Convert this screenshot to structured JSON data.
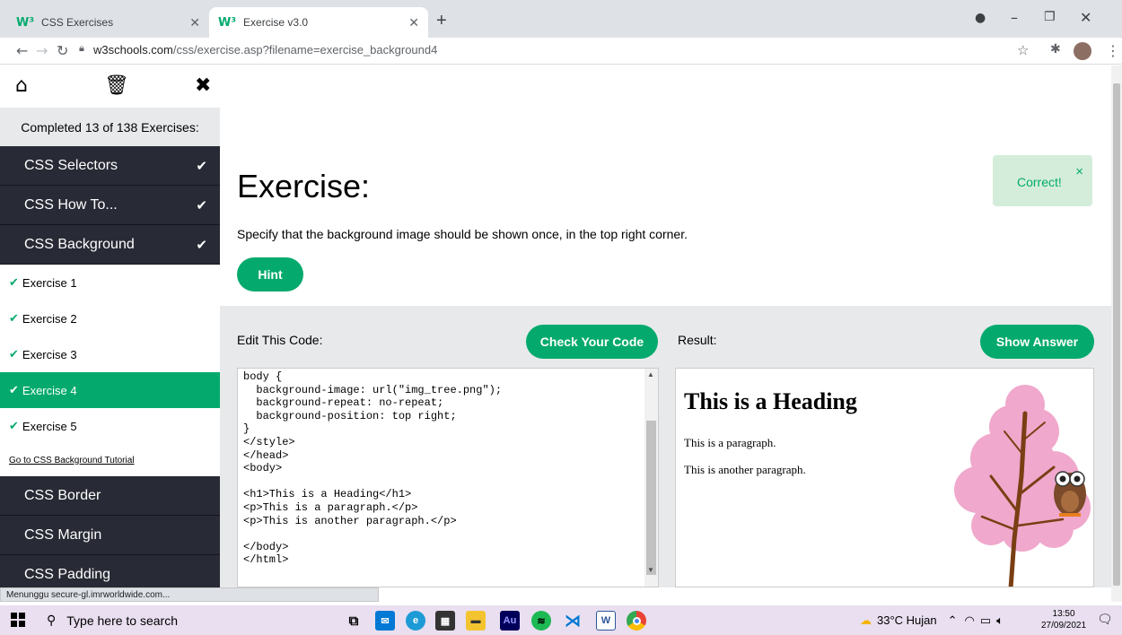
{
  "browser": {
    "tabs": [
      {
        "title": "CSS Exercises",
        "favicon": "W³",
        "active": false
      },
      {
        "title": "Exercise v3.0",
        "favicon": "W³",
        "active": true
      }
    ],
    "url_host": "w3schools.com",
    "url_path": "/css/exercise.asp?filename=exercise_background4",
    "status_text": "Menunggu secure-gl.imrworldwide.com..."
  },
  "sidebar": {
    "progress": "Completed 13 of 138 Exercises:",
    "categories_top": [
      {
        "label": "CSS Selectors",
        "done": true
      },
      {
        "label": "CSS How To...",
        "done": true
      },
      {
        "label": "CSS Background",
        "done": true
      }
    ],
    "exercises": [
      {
        "label": "Exercise 1",
        "active": false
      },
      {
        "label": "Exercise 2",
        "active": false
      },
      {
        "label": "Exercise 3",
        "active": false
      },
      {
        "label": "Exercise 4",
        "active": true
      },
      {
        "label": "Exercise 5",
        "active": false
      }
    ],
    "tutorial_link": "Go to CSS Background Tutorial",
    "categories_bottom": [
      {
        "label": "CSS Border"
      },
      {
        "label": "CSS Margin"
      },
      {
        "label": "CSS Padding"
      }
    ]
  },
  "exercise": {
    "title": "Exercise:",
    "description": "Specify that the background image should be shown once, in the top right corner.",
    "hint_label": "Hint",
    "feedback": "Correct!",
    "feedback_close": "×"
  },
  "editor": {
    "label": "Edit This Code:",
    "check_label": "Check Your Code",
    "code": "body {\n  background-image: url(\"img_tree.png\");\n  background-repeat: no-repeat;\n  background-position: top right;\n}\n</style>\n</head>\n<body>\n\n<h1>This is a Heading</h1>\n<p>This is a paragraph.</p>\n<p>This is another paragraph.</p>\n\n</body>\n</html>"
  },
  "result": {
    "label": "Result:",
    "answer_label": "Show Answer",
    "heading": "This is a Heading",
    "paragraph1": "This is a paragraph.",
    "paragraph2": "This is another paragraph."
  },
  "taskbar": {
    "search_placeholder": "Type here to search",
    "weather": "33°C  Hujan",
    "time": "13:50",
    "date": "27/09/2021",
    "apps": [
      "task-view",
      "mail",
      "edge",
      "store",
      "file-explorer",
      "adobe-audition",
      "spotify",
      "vscode",
      "word",
      "chrome"
    ]
  },
  "colors": {
    "accent": "#04aa6d",
    "sidebar_dark": "#282a35",
    "feedback_bg": "#d4edda"
  }
}
